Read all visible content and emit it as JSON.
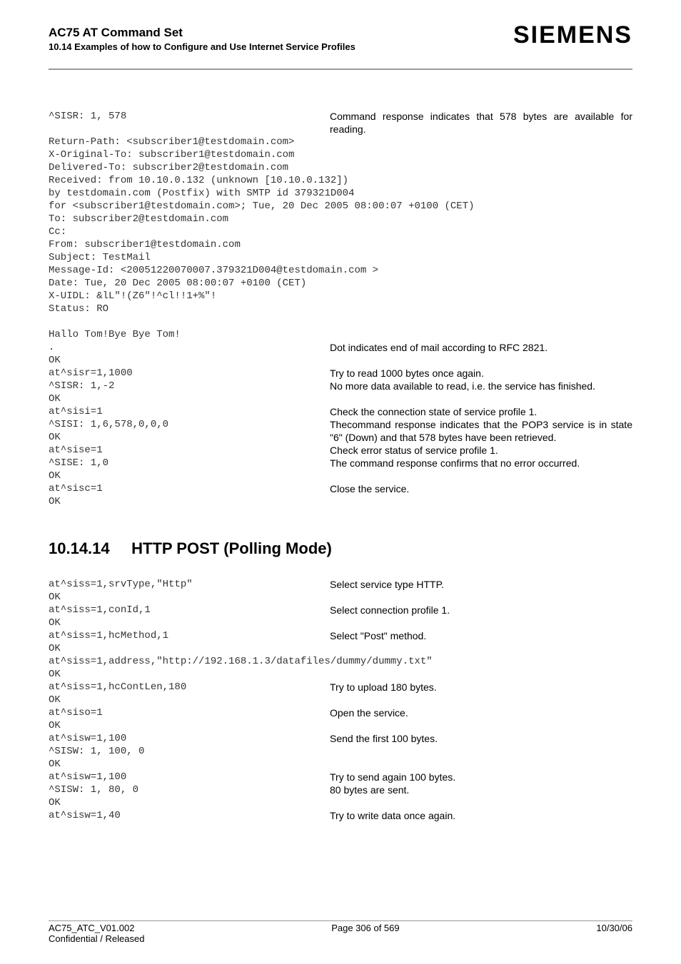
{
  "header": {
    "doc_title": "AC75 AT Command Set",
    "doc_subtitle": "10.14 Examples of how to Configure and Use Internet Service Profiles",
    "brand": "SIEMENS"
  },
  "block1": {
    "row_sisr": {
      "cmd": "^SISR: 1, 578",
      "desc": "Command response indicates that 578 bytes are available for reading."
    },
    "mail_lines": [
      "Return-Path: <subscriber1@testdomain.com>",
      "X-Original-To: subscriber1@testdomain.com",
      "Delivered-To: subscriber2@testdomain.com",
      "Received: from 10.10.0.132 (unknown [10.10.0.132])",
      "by testdomain.com (Postfix) with SMTP id 379321D004",
      "for <subscriber1@testdomain.com>; Tue, 20 Dec 2005 08:00:07 +0100 (CET)",
      "To: subscriber2@testdomain.com",
      "Cc:",
      "From: subscriber1@testdomain.com",
      "Subject: TestMail",
      "Message-Id: <20051220070007.379321D004@testdomain.com >",
      "Date: Tue, 20 Dec 2005 08:00:07 +0100 (CET)",
      "X-UIDL: &lL\"!(Z6\"!^cl!!1+%\"!",
      "Status: RO",
      "",
      "Hallo Tom!Bye Bye Tom!"
    ],
    "row_dot": {
      "cmd": ".",
      "desc": "Dot indicates end of mail according to RFC 2821."
    },
    "row_ok1": {
      "cmd": "OK",
      "desc": ""
    },
    "row_sisr2": {
      "cmd": "at^sisr=1,1000",
      "desc": "Try to read 1000 bytes once again."
    },
    "row_sisr3": {
      "cmd": "^SISR: 1,-2",
      "desc": "No more data available to read, i.e. the service has finished."
    },
    "row_ok2": {
      "cmd": "OK",
      "desc": ""
    },
    "row_sisi": {
      "cmd": "at^sisi=1",
      "desc": "Check the connection state of service profile 1."
    },
    "row_sisi2": {
      "cmd": "^SISI: 1,6,578,0,0,0",
      "desc": "Thecommand response indicates that the POP3 service is in state \"6\" (Down) and that 578 bytes have been retrieved."
    },
    "row_ok3": {
      "cmd": "OK",
      "desc": ""
    },
    "row_sise": {
      "cmd": "at^sise=1",
      "desc": "Check error status of service profile 1."
    },
    "row_sise2": {
      "cmd": "^SISE: 1,0",
      "desc": "The command response confirms that no error occurred."
    },
    "row_ok4": {
      "cmd": "OK",
      "desc": ""
    },
    "row_sisc": {
      "cmd": "at^sisc=1",
      "desc": "Close the service."
    },
    "row_ok5": {
      "cmd": "OK",
      "desc": ""
    }
  },
  "section": {
    "number": "10.14.14",
    "title": "HTTP POST (Polling Mode)"
  },
  "block2": {
    "r1": {
      "cmd": "at^siss=1,srvType,\"Http\"",
      "desc": "Select service type HTTP."
    },
    "r2": {
      "cmd": "OK",
      "desc": ""
    },
    "r3": {
      "cmd": "at^siss=1,conId,1",
      "desc": "Select connection profile 1."
    },
    "r4": {
      "cmd": "OK",
      "desc": ""
    },
    "r5": {
      "cmd": "at^siss=1,hcMethod,1",
      "desc": "Select \"Post\" method."
    },
    "r6": {
      "cmd": "OK",
      "desc": ""
    },
    "r7": {
      "cmd": "at^siss=1,address,\"http://192.168.1.3/datafiles/dummy/dummy.txt\"",
      "desc": ""
    },
    "r8": {
      "cmd": "OK",
      "desc": ""
    },
    "r9": {
      "cmd": "at^siss=1,hcContLen,180",
      "desc": "Try to upload 180 bytes."
    },
    "r10": {
      "cmd": "OK",
      "desc": ""
    },
    "r11": {
      "cmd": "at^siso=1",
      "desc": "Open the service."
    },
    "r12": {
      "cmd": "OK",
      "desc": ""
    },
    "r13": {
      "cmd": "at^sisw=1,100",
      "desc": "Send the first 100 bytes."
    },
    "r14": {
      "cmd": "^SISW: 1, 100, 0",
      "desc": ""
    },
    "r15": {
      "cmd": "OK",
      "desc": ""
    },
    "r16": {
      "cmd": "at^sisw=1,100",
      "desc": "Try to send again 100 bytes."
    },
    "r17": {
      "cmd": "^SISW: 1, 80, 0",
      "desc": "80 bytes are sent."
    },
    "r18": {
      "cmd": "OK",
      "desc": ""
    },
    "r19": {
      "cmd": "at^sisw=1,40",
      "desc": "Try to write data once again."
    }
  },
  "footer": {
    "left1": "AC75_ATC_V01.002",
    "center1": "Page 306 of 569",
    "right1": "10/30/06",
    "left2": "Confidential / Released"
  }
}
